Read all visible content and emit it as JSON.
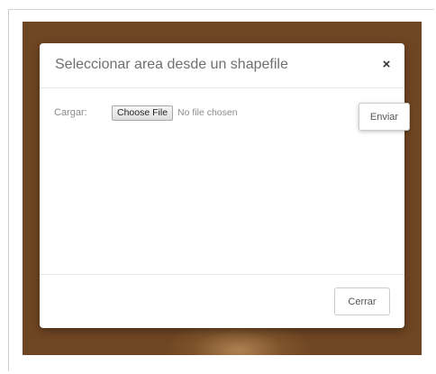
{
  "modal": {
    "title": "Seleccionar area desde un shapefile",
    "close_icon": "×"
  },
  "form": {
    "label": "Cargar:",
    "choose_file_label": "Choose File",
    "file_status": "No file chosen",
    "submit_label": "Enviar"
  },
  "footer": {
    "close_label": "Cerrar"
  },
  "colors": {
    "backdrop": "#6f4623",
    "title_text": "#6f6f6f",
    "modal_background": "#ffffff"
  },
  "icons": {
    "close": "close-icon"
  }
}
